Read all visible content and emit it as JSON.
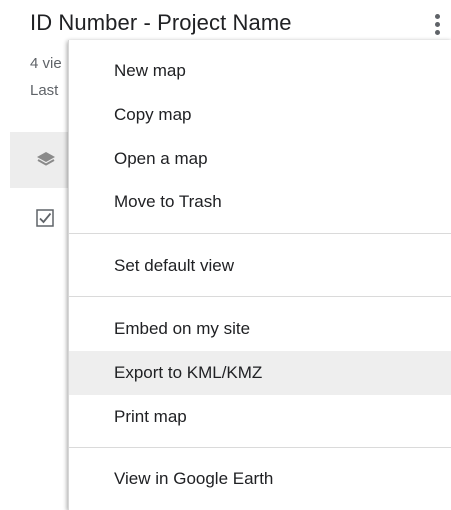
{
  "panel": {
    "title": "ID Number - Project Name",
    "views_text": "4 vie",
    "last_text": "Last"
  },
  "icons": {
    "more": "more-vert-icon",
    "layers": "layers-icon",
    "checkbox": "checkbox-checked-icon"
  },
  "menu": {
    "items": [
      {
        "label": "New map"
      },
      {
        "label": "Copy map"
      },
      {
        "label": "Open a map"
      },
      {
        "label": "Move to Trash"
      },
      {
        "label": "Set default view"
      },
      {
        "label": "Embed on my site"
      },
      {
        "label": "Export to KML/KMZ",
        "highlighted": true
      },
      {
        "label": "Print map"
      },
      {
        "label": "View in Google Earth"
      }
    ]
  },
  "colors": {
    "text_primary": "#202124",
    "text_secondary": "#5f6368",
    "highlight": "#eeeeee",
    "divider": "#dadada"
  }
}
